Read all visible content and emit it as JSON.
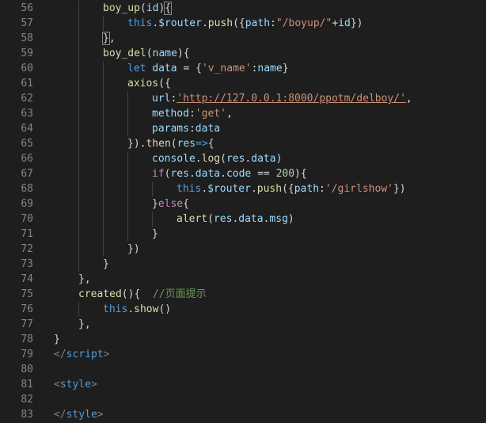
{
  "theme": {
    "background": "#1e1e1e",
    "line_number": "#858585",
    "default": "#d4d4d4",
    "keyword": "#569cd6",
    "function": "#dcdcaa",
    "variable": "#9cdcfe",
    "property": "#9cdcfe",
    "string": "#ce9178",
    "number": "#b5cea8",
    "comment": "#6a9955",
    "control": "#c586c0",
    "punctuation": "#d4d4d4",
    "tag": "#808080"
  },
  "lines": [
    {
      "num": "56",
      "indent": 2,
      "tokens": [
        [
          "boy_up",
          "function"
        ],
        [
          "(",
          "punctuation"
        ],
        [
          "id",
          "variable"
        ],
        [
          "){",
          "punctuation"
        ]
      ],
      "guides": [
        1
      ]
    },
    {
      "num": "57",
      "indent": 3,
      "tokens": [
        [
          "this",
          "keyword"
        ],
        [
          ".",
          "punctuation"
        ],
        [
          "$router",
          "variable"
        ],
        [
          ".",
          "punctuation"
        ],
        [
          "push",
          "function"
        ],
        [
          "({",
          "punctuation"
        ],
        [
          "path",
          "property"
        ],
        [
          ":",
          "punctuation"
        ],
        [
          "\"/boyup/\"",
          "string"
        ],
        [
          "+",
          "punctuation"
        ],
        [
          "id",
          "variable"
        ],
        [
          "})",
          "punctuation"
        ]
      ],
      "guides": [
        1,
        2
      ]
    },
    {
      "num": "58",
      "indent": 2,
      "tokens": [
        [
          "}",
          "punctuation"
        ],
        [
          ",",
          "punctuation"
        ]
      ],
      "guides": [
        1
      ]
    },
    {
      "num": "59",
      "indent": 2,
      "tokens": [
        [
          "boy_del",
          "function"
        ],
        [
          "(",
          "punctuation"
        ],
        [
          "name",
          "variable"
        ],
        [
          "){",
          "punctuation"
        ]
      ],
      "guides": [
        1
      ]
    },
    {
      "num": "60",
      "indent": 3,
      "tokens": [
        [
          "let",
          "keyword"
        ],
        [
          " ",
          "punctuation"
        ],
        [
          "data",
          "variable"
        ],
        [
          " = {",
          "punctuation"
        ],
        [
          "'v_name'",
          "string"
        ],
        [
          ":",
          "punctuation"
        ],
        [
          "name",
          "variable"
        ],
        [
          "}",
          "punctuation"
        ]
      ],
      "guides": [
        1,
        2
      ]
    },
    {
      "num": "61",
      "indent": 3,
      "tokens": [
        [
          "axios",
          "function"
        ],
        [
          "({",
          "punctuation"
        ]
      ],
      "guides": [
        1,
        2
      ]
    },
    {
      "num": "62",
      "indent": 4,
      "tokens": [
        [
          "url",
          "property"
        ],
        [
          ":",
          "punctuation"
        ],
        [
          "'http://127.0.0.1:8000/ppotm/delboy/'",
          "string"
        ],
        [
          ",",
          "punctuation"
        ]
      ],
      "guides": [
        1,
        2,
        3
      ]
    },
    {
      "num": "63",
      "indent": 4,
      "tokens": [
        [
          "method",
          "property"
        ],
        [
          ":",
          "punctuation"
        ],
        [
          "'get'",
          "string"
        ],
        [
          ",",
          "punctuation"
        ]
      ],
      "guides": [
        1,
        2,
        3
      ]
    },
    {
      "num": "64",
      "indent": 4,
      "tokens": [
        [
          "params",
          "property"
        ],
        [
          ":",
          "punctuation"
        ],
        [
          "data",
          "variable"
        ]
      ],
      "guides": [
        1,
        2,
        3
      ]
    },
    {
      "num": "65",
      "indent": 3,
      "tokens": [
        [
          "}).",
          "punctuation"
        ],
        [
          "then",
          "function"
        ],
        [
          "(",
          "punctuation"
        ],
        [
          "res",
          "variable"
        ],
        [
          "=>",
          "keyword"
        ],
        [
          "{",
          "punctuation"
        ]
      ],
      "guides": [
        1,
        2
      ]
    },
    {
      "num": "66",
      "indent": 4,
      "tokens": [
        [
          "console",
          "variable"
        ],
        [
          ".",
          "punctuation"
        ],
        [
          "log",
          "function"
        ],
        [
          "(",
          "punctuation"
        ],
        [
          "res",
          "variable"
        ],
        [
          ".",
          "punctuation"
        ],
        [
          "data",
          "variable"
        ],
        [
          ")",
          "punctuation"
        ]
      ],
      "guides": [
        1,
        2,
        3
      ]
    },
    {
      "num": "67",
      "indent": 4,
      "tokens": [
        [
          "if",
          "control"
        ],
        [
          "(",
          "punctuation"
        ],
        [
          "res",
          "variable"
        ],
        [
          ".",
          "punctuation"
        ],
        [
          "data",
          "variable"
        ],
        [
          ".",
          "punctuation"
        ],
        [
          "code",
          "variable"
        ],
        [
          " == ",
          "punctuation"
        ],
        [
          "200",
          "number"
        ],
        [
          "){",
          "punctuation"
        ]
      ],
      "guides": [
        1,
        2,
        3
      ]
    },
    {
      "num": "68",
      "indent": 5,
      "tokens": [
        [
          "this",
          "keyword"
        ],
        [
          ".",
          "punctuation"
        ],
        [
          "$router",
          "variable"
        ],
        [
          ".",
          "punctuation"
        ],
        [
          "push",
          "function"
        ],
        [
          "({",
          "punctuation"
        ],
        [
          "path",
          "property"
        ],
        [
          ":",
          "punctuation"
        ],
        [
          "'/girlshow'",
          "string"
        ],
        [
          "})",
          "punctuation"
        ]
      ],
      "guides": [
        1,
        2,
        3,
        4
      ]
    },
    {
      "num": "69",
      "indent": 4,
      "tokens": [
        [
          "}",
          "punctuation"
        ],
        [
          "else",
          "control"
        ],
        [
          "{",
          "punctuation"
        ]
      ],
      "guides": [
        1,
        2,
        3
      ]
    },
    {
      "num": "70",
      "indent": 5,
      "tokens": [
        [
          "alert",
          "function"
        ],
        [
          "(",
          "punctuation"
        ],
        [
          "res",
          "variable"
        ],
        [
          ".",
          "punctuation"
        ],
        [
          "data",
          "variable"
        ],
        [
          ".",
          "punctuation"
        ],
        [
          "msg",
          "variable"
        ],
        [
          ")",
          "punctuation"
        ]
      ],
      "guides": [
        1,
        2,
        3,
        4
      ]
    },
    {
      "num": "71",
      "indent": 4,
      "tokens": [
        [
          "}",
          "punctuation"
        ]
      ],
      "guides": [
        1,
        2,
        3
      ]
    },
    {
      "num": "72",
      "indent": 3,
      "tokens": [
        [
          "})",
          "punctuation"
        ]
      ],
      "guides": [
        1,
        2
      ]
    },
    {
      "num": "73",
      "indent": 2,
      "tokens": [
        [
          "}",
          "punctuation"
        ]
      ],
      "guides": [
        1
      ]
    },
    {
      "num": "74",
      "indent": 1,
      "tokens": [
        [
          "},",
          "punctuation"
        ]
      ],
      "guides": []
    },
    {
      "num": "75",
      "indent": 1,
      "tokens": [
        [
          "created",
          "function"
        ],
        [
          "(){",
          "punctuation"
        ],
        [
          "  ",
          "punctuation"
        ],
        [
          "//页面提示",
          "comment"
        ]
      ],
      "guides": []
    },
    {
      "num": "76",
      "indent": 2,
      "tokens": [
        [
          "this",
          "keyword"
        ],
        [
          ".",
          "punctuation"
        ],
        [
          "show",
          "function"
        ],
        [
          "()",
          "punctuation"
        ]
      ],
      "guides": [
        1
      ]
    },
    {
      "num": "77",
      "indent": 1,
      "tokens": [
        [
          "},",
          "punctuation"
        ]
      ],
      "guides": []
    },
    {
      "num": "78",
      "indent": 0,
      "tokens": [
        [
          "}",
          "punctuation"
        ]
      ],
      "guides": []
    },
    {
      "num": "79",
      "indent": 0,
      "tokens": [
        [
          "</",
          "tag"
        ],
        [
          "script",
          "keyword"
        ],
        [
          ">",
          "tag"
        ]
      ],
      "guides": []
    },
    {
      "num": "80",
      "indent": 0,
      "tokens": [],
      "guides": []
    },
    {
      "num": "81",
      "indent": 0,
      "tokens": [
        [
          "<",
          "tag"
        ],
        [
          "style",
          "keyword"
        ],
        [
          ">",
          "tag"
        ]
      ],
      "guides": []
    },
    {
      "num": "82",
      "indent": 0,
      "tokens": [],
      "guides": []
    },
    {
      "num": "83",
      "indent": 0,
      "tokens": [
        [
          "</",
          "tag"
        ],
        [
          "style",
          "keyword"
        ],
        [
          ">",
          "tag"
        ]
      ],
      "guides": []
    }
  ]
}
